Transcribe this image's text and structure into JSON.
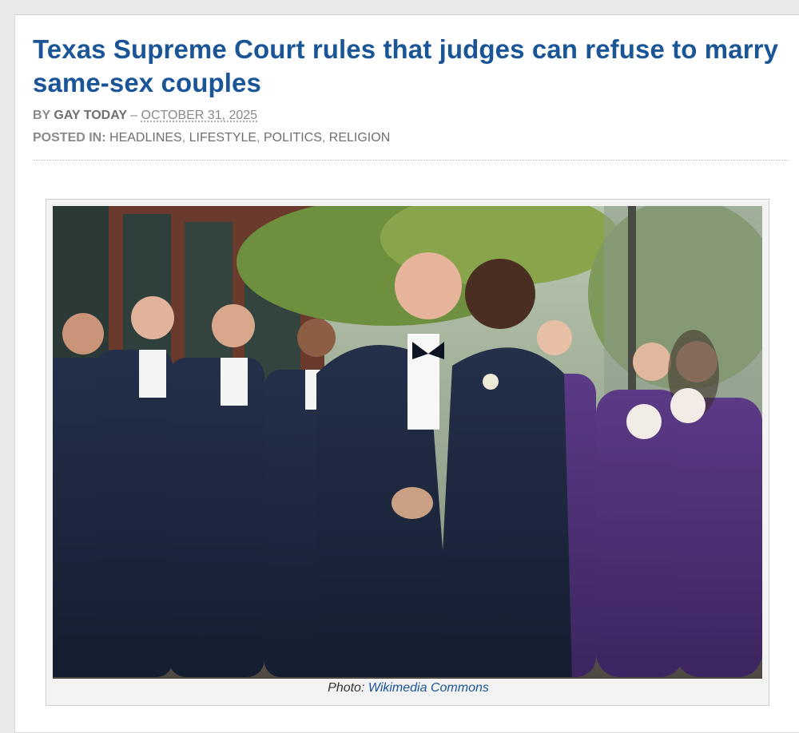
{
  "article": {
    "title": "Texas Supreme Court rules that judges can refuse to marry same-sex couples",
    "byline": {
      "prefix": "BY",
      "author": "GAY TODAY",
      "separator": "–",
      "date": "OCTOBER 31, 2025"
    },
    "posted_in": {
      "label": "POSTED IN:",
      "categories": [
        "HEADLINES",
        "LIFESTYLE",
        "POLITICS",
        "RELIGION"
      ],
      "separator": ", "
    }
  },
  "figure": {
    "image_alt": "Two grooms in navy tuxedos kissing in front of groomsmen and bridesmaids in purple gowns",
    "caption_prefix": "Photo:",
    "caption_link": "Wikimedia Commons"
  },
  "colors": {
    "title": "#1a5598",
    "meta": "#8a8a8a",
    "link": "#1a5598"
  }
}
